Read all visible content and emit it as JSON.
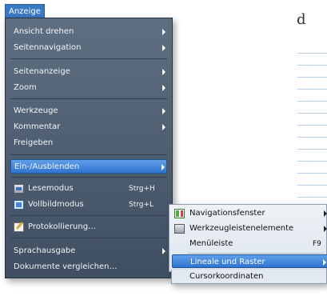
{
  "menubar": {
    "active_menu": "Anzeige"
  },
  "background": {
    "text": "d"
  },
  "menu": {
    "items": [
      {
        "label": "Ansicht drehen",
        "submenu": true
      },
      {
        "label": "Seitennavigation",
        "submenu": true
      },
      {
        "label": "Seitenanzeige",
        "submenu": true
      },
      {
        "label": "Zoom",
        "submenu": true
      },
      {
        "label": "Werkzeuge",
        "submenu": true
      },
      {
        "label": "Kommentar",
        "submenu": true
      },
      {
        "label": "Freigeben",
        "submenu": false
      },
      {
        "label": "Ein-/Ausblenden",
        "submenu": true,
        "active": true
      },
      {
        "label": "Lesemodus",
        "shortcut": "Strg+H",
        "icon": "reading-mode-icon"
      },
      {
        "label": "Vollbildmodus",
        "shortcut": "Strg+L",
        "icon": "fullscreen-icon"
      },
      {
        "label": "Protokollierung…",
        "icon": "logging-icon"
      },
      {
        "label": "Sprachausgabe",
        "submenu": true
      },
      {
        "label": "Dokumente vergleichen…",
        "submenu": false
      }
    ]
  },
  "submenu": {
    "items": [
      {
        "label": "Navigationsfenster",
        "submenu": true,
        "icon": "navigation-pane-icon"
      },
      {
        "label": "Werkzeugleistenelemente",
        "submenu": true,
        "icon": "toolbar-icon"
      },
      {
        "label": "Menüleiste",
        "shortcut": "F9"
      },
      {
        "label": "Lineale und Raster",
        "submenu": true,
        "active": true
      },
      {
        "label": "Cursorkoordinaten"
      }
    ]
  },
  "colors": {
    "menu_bg": "#4f5e70",
    "highlight": "#3a7fd5",
    "submenu_bg": "#e6ebf2"
  }
}
